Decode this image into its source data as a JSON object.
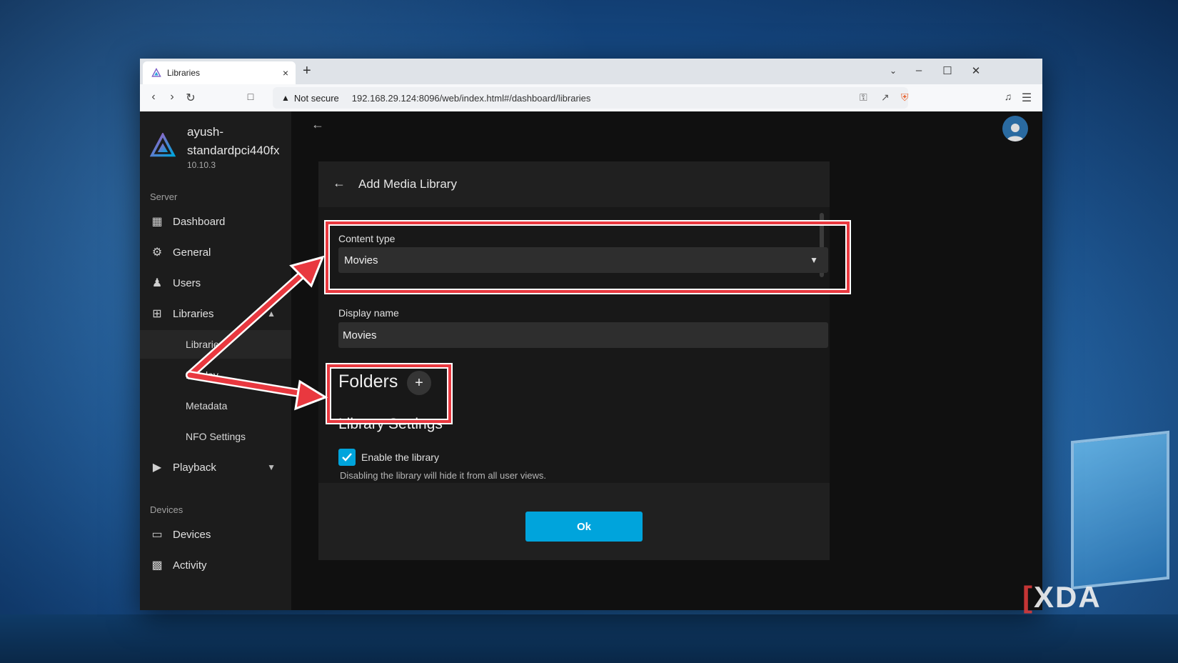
{
  "browser": {
    "tab_title": "Libraries",
    "new_tab": "+",
    "close_tab": "×",
    "address": {
      "security_label": "Not secure",
      "url": "192.168.29.124:8096/web/index.html#/dashboard/libraries"
    }
  },
  "sidebar": {
    "server_name": "ayush-standardpci440fx",
    "server_version": "10.10.3",
    "section_server": "Server",
    "section_devices": "Devices",
    "items": {
      "dashboard": "Dashboard",
      "general": "General",
      "users": "Users",
      "libraries": "Libraries",
      "playback": "Playback",
      "devices": "Devices",
      "activity": "Activity"
    },
    "library_sub": {
      "libraries": "Libraries",
      "display": "Display",
      "metadata": "Metadata",
      "nfo": "NFO Settings"
    }
  },
  "dialog": {
    "title": "Add Media Library",
    "content_type_label": "Content type",
    "content_type_value": "Movies",
    "display_name_label": "Display name",
    "display_name_value": "Movies",
    "folders_title": "Folders",
    "add_folder": "+",
    "library_settings_title": "Library Settings",
    "enable_label": "Enable the library",
    "enable_help": "Disabling the library will hide it from all user views.",
    "enable_checked": true,
    "ok_label": "Ok"
  },
  "watermark": {
    "brand": "XDA"
  },
  "colors": {
    "accent": "#00a4dc",
    "highlight": "#e9383f",
    "sidebar_bg": "#1c1c1c",
    "dialog_bg": "#202020"
  }
}
